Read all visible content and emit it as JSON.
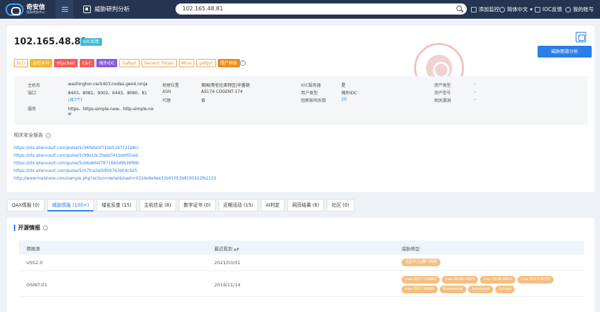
{
  "header": {
    "logo_name": "奇安信",
    "logo_sub": "威胁情报中心",
    "app_title": "威胁研判分析",
    "search_value": "102.165.48.81",
    "add_monitor": "添加监控",
    "language": "简体中文",
    "ioc_feedback": "IOC反馈",
    "account": "我的账号"
  },
  "summary": {
    "ip": "102.165.48.81",
    "ioc_badge": "IOC反馈",
    "analyze_button": "威胁图谱分析",
    "tags": [
      "BLD",
      "远控木马",
      "Hijacked",
      "C&C",
      "境外IDC",
      "Gafgyt",
      "Generic Trojan",
      "Mirai",
      "gafgyt",
      "僵尸网络"
    ],
    "stamp_text": "恶意"
  },
  "info": {
    "hostname_label": "主机名",
    "hostname": "washington-rack403.nodes.gen4.ninja",
    "port_label": "端口",
    "ports": "8443、8081、9002、6443、8080、81",
    "ports_more": "(共7个)",
    "service_label": "服务",
    "services_line1": "https、https-simple-new、http-simple-ne",
    "services_line2": "w",
    "location_label": "地理位置",
    "location": "美国|哥伦比亚特区|华盛顿",
    "asn_label": "ASN",
    "asn": "AS174 COGENT-174",
    "proxy_label": "代理",
    "proxy": "否",
    "ioc_server_label": "IOC服务器",
    "ioc_server": "是",
    "user_type_label": "用户类型",
    "user_type": "境外IDC",
    "affected_label": "阻断影响系数",
    "affected": "20",
    "asset_type_label": "资产类型",
    "asset_type": "-",
    "asset_model_label": "资产型号",
    "asset_model": "-",
    "vuln_label": "相关漏洞",
    "vuln": "-"
  },
  "reports": {
    "title": "相关安全报告",
    "links": [
      "https://otx.alienvault.com/pulse/5c96febe5f71bb5187721b8c/",
      "https://otx.alienvault.com/pulse/5c99a1dc3fadd741dabf01ed/",
      "https://otx.alienvault.com/pulse/5cb6a86af7871640d9936f88/",
      "https://otx.alienvault.com/pulse/5cb7fca2e00f06793b04c92f/",
      "http://www.malshare.com/sample.php?action=detail&hash=032de9e9ee32b91053b8195422fb2133"
    ]
  },
  "tabs": [
    {
      "label": "QAX情报 (0)"
    },
    {
      "label": "威胁情报 (100+)"
    },
    {
      "label": "域名反查 (15)"
    },
    {
      "label": "主机信息 (8)"
    },
    {
      "label": "数字证书 (0)"
    },
    {
      "label": "近期活动 (15)"
    },
    {
      "label": "AI判定"
    },
    {
      "label": "网页结果 (6)"
    },
    {
      "label": "社区 (0)"
    }
  ],
  "open_intel": {
    "title": "开源情报",
    "columns": [
      "情报源",
      "最近看到",
      "威胁类型"
    ],
    "rows": [
      {
        "source": "USS2.0",
        "last_seen": "2021/03/01",
        "types": [
          "远控木马/僵尸网络"
        ]
      },
      {
        "source": "OSINT-01",
        "last_seen": "2019/11/14",
        "types": [
          "cve-2017-10882",
          "cve-2018-2893",
          "cve-2018-0802",
          "cve-2017-8570",
          "cve-2017-8464",
          "bladabindi",
          "honeypot",
          "tvlinks"
        ]
      }
    ]
  },
  "colors": {
    "topbar": "#243451",
    "accent": "#2b7de9",
    "ioc_badge": "#3fbbd6",
    "threat_tag": "#f5be80"
  }
}
